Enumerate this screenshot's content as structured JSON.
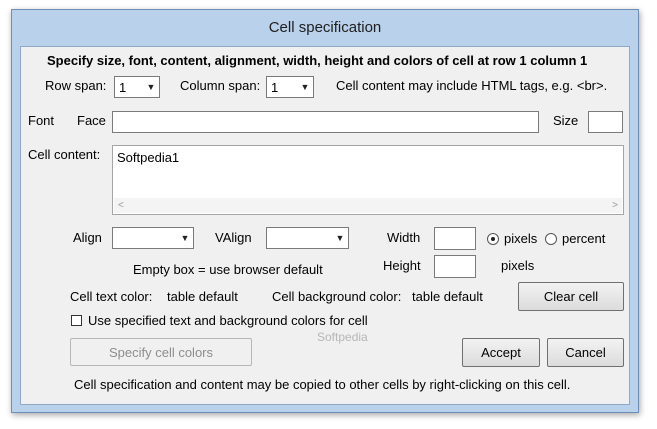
{
  "window": {
    "title": "Cell specification"
  },
  "header": {
    "text": "Specify size, font, content, alignment, width, height and colors of cell at row 1 column 1"
  },
  "row_span": {
    "label": "Row span:",
    "value": "1"
  },
  "column_span": {
    "label": "Column span:",
    "value": "1"
  },
  "html_note": "Cell content may include HTML tags, e.g. <br>.",
  "font": {
    "label": "Font",
    "face_label": "Face",
    "face_value": "",
    "size_label": "Size",
    "size_value": ""
  },
  "cell_content": {
    "label": "Cell content:",
    "value": "Softpedia1"
  },
  "align": {
    "label": "Align",
    "value": ""
  },
  "valign": {
    "label": "VAlign",
    "value": ""
  },
  "width": {
    "label": "Width",
    "value": "",
    "unit_pixels": "pixels",
    "unit_percent": "percent",
    "selected_unit": "pixels"
  },
  "height": {
    "label": "Height",
    "value": "",
    "unit": "pixels"
  },
  "empty_box_note": "Empty box = use browser default",
  "text_color": {
    "label": "Cell text color:",
    "value": "table default"
  },
  "background_color": {
    "label": "Cell background color:",
    "value": "table default"
  },
  "buttons": {
    "clear_cell": "Clear cell",
    "specify_colors": "Specify cell colors",
    "accept": "Accept",
    "cancel": "Cancel"
  },
  "use_colors_checkbox": {
    "label": "Use specified text and background colors for cell",
    "checked": false
  },
  "footer_note": "Cell specification and content may be copied to other cells by right-clicking on this cell.",
  "watermark": "Softpedia",
  "colors": {
    "title_bar": "#b9d1ea",
    "client_bg": "#f0f0f0"
  }
}
